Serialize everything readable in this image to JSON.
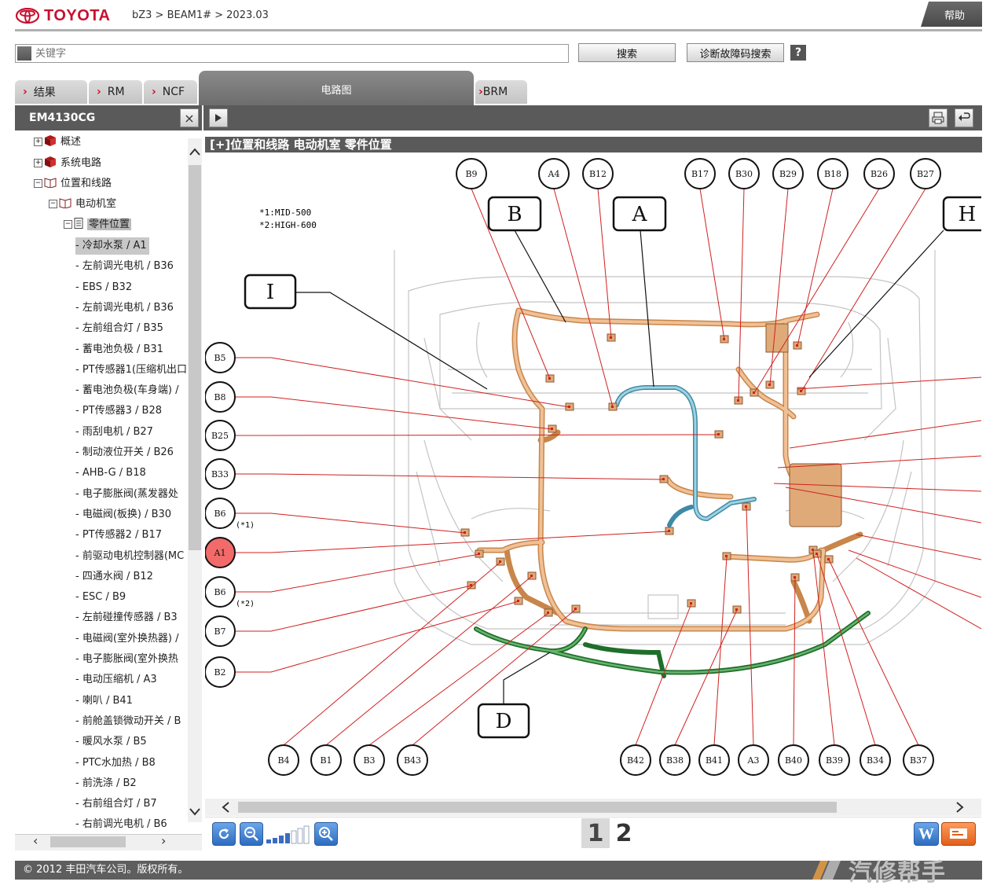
{
  "header": {
    "brand": "TOYOTA",
    "breadcrumb": "bZ3 > BEAM1# > 2023.03",
    "help_label": "帮助"
  },
  "search": {
    "placeholder": "关键字",
    "search_label": "搜索",
    "dtc_label": "诊断故障码搜索",
    "help_icon_label": "?"
  },
  "tabs": [
    {
      "label": "结果",
      "chevron": "›"
    },
    {
      "label": "RM",
      "chevron": "›"
    },
    {
      "label": "NCF",
      "chevron": "›"
    },
    {
      "label": "电路图"
    },
    {
      "label": "BRM",
      "chevron": "›"
    }
  ],
  "left_panel": {
    "title": "EM4130CG",
    "close_label": "×",
    "tree": [
      {
        "label": "概述",
        "toggle": "+"
      },
      {
        "label": "系统电路",
        "toggle": "+"
      },
      {
        "label": "位置和线路",
        "toggle": "−"
      },
      {
        "label": "电动机室",
        "toggle": "−"
      },
      {
        "label": "零件位置",
        "toggle": "−"
      }
    ],
    "leaves": [
      "- 冷却水泵 / A1",
      "- 左前调光电机 / B36",
      "- EBS / B32",
      "- 左前调光电机 / B36",
      "- 左前组合灯 / B35",
      "- 蓄电池负极 / B31",
      "- PT传感器1(压缩机出口",
      "- 蓄电池负极(车身端) /",
      "- PT传感器3 / B28",
      "- 雨刮电机 / B27",
      "- 制动液位开关 / B26",
      "- AHB-G / B18",
      "- 电子膨胀阀(蒸发器处",
      "- 电磁阀(板换) / B30",
      "- PT传感器2 / B17",
      "- 前驱动电机控制器(MC",
      "- 四通水阀 / B12",
      "- ESC / B9",
      "- 左前碰撞传感器 / B3",
      "- 电磁阀(室外换热器) /",
      "- 电子膨胀阀(室外换热",
      "- 电动压缩机 / A3",
      "- 喇叭 / B41",
      "- 前舱盖锁微动开关 / B",
      "- 暖风水泵 / B5",
      "- PTC水加热 / B8",
      "- 前洗涤 / B2",
      "- 右前组合灯 / B7",
      "- 右前调光电机 / B6"
    ],
    "selected_leaf": 0,
    "scroll_left": "‹",
    "scroll_right": "›"
  },
  "diagram": {
    "title": "[+]位置和线路  电动机室  零件位置",
    "notes": [
      "*1:MID-500",
      "*2:HIGH-600"
    ],
    "top_connectors": [
      "B9",
      "A4",
      "B12",
      "B17",
      "B30",
      "B29",
      "B18",
      "B26",
      "B27"
    ],
    "left_connectors": [
      "B5",
      "B8",
      "B25",
      "B33",
      "B6",
      "A1",
      "B6",
      "B7",
      "B2"
    ],
    "left_notes": [
      "(*1)",
      "(*2)"
    ],
    "bottom_connectors": [
      "B4",
      "B1",
      "B3",
      "B43",
      "B42",
      "B38",
      "B41",
      "A3",
      "B40",
      "B39",
      "B34",
      "B37"
    ],
    "harness_labels": [
      "B",
      "A",
      "H",
      "I",
      "D"
    ],
    "highlighted": "A1",
    "colors": {
      "harness_main": "#e0a978",
      "harness_blue": "#6fb3c9",
      "harness_green": "#2f8a3a",
      "leader": "#d02020",
      "highlight": "#f26a6a"
    }
  },
  "pager": {
    "pages": [
      "1",
      "2"
    ],
    "current": "1"
  },
  "footer": {
    "copyright": "© 2012 丰田汽车公司。版权所有。"
  },
  "watermark": {
    "text": "汽修帮手"
  }
}
